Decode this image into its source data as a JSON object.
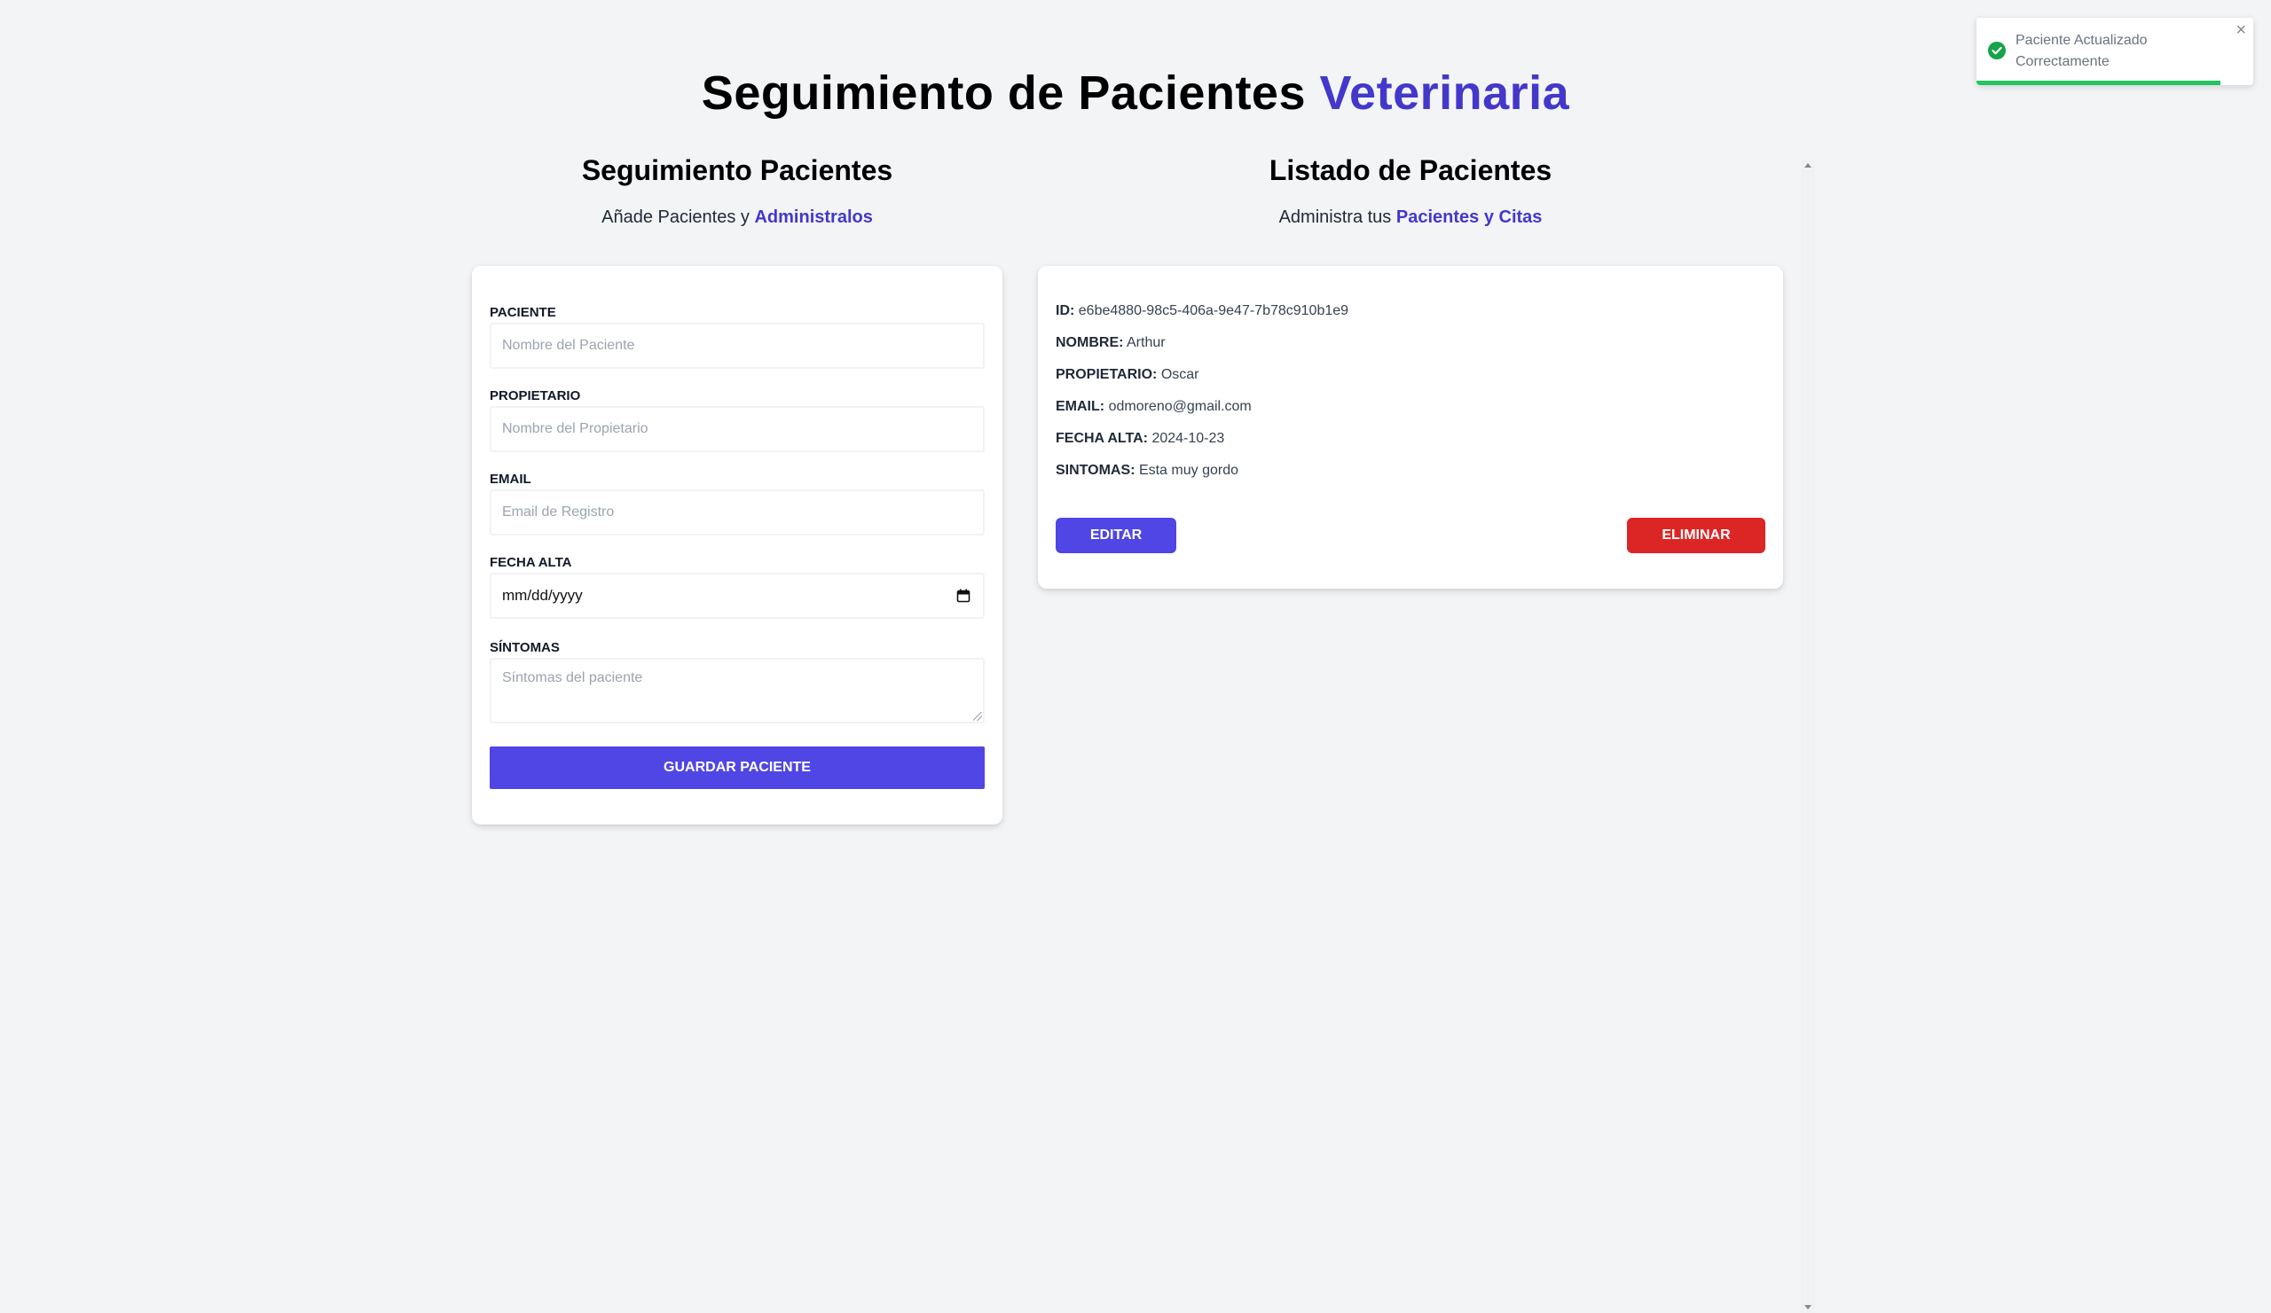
{
  "header": {
    "title_main": "Seguimiento de Pacientes",
    "title_accent": "Veterinaria"
  },
  "form_section": {
    "heading": "Seguimiento Pacientes",
    "subtitle_prefix": "Añade Pacientes y",
    "subtitle_accent": "Administralos",
    "fields": {
      "paciente": {
        "label": "PACIENTE",
        "placeholder": "Nombre del Paciente",
        "value": ""
      },
      "propietario": {
        "label": "PROPIETARIO",
        "placeholder": "Nombre del Propietario",
        "value": ""
      },
      "email": {
        "label": "EMAIL",
        "placeholder": "Email de Registro",
        "value": ""
      },
      "fecha_alta": {
        "label": "FECHA ALTA",
        "display": "mm/dd/yyyy"
      },
      "sintomas": {
        "label": "SÍNTOMAS",
        "placeholder": "Síntomas del paciente",
        "value": ""
      }
    },
    "submit_label": "GUARDAR PACIENTE"
  },
  "list_section": {
    "heading": "Listado de Pacientes",
    "subtitle_prefix": "Administra tus",
    "subtitle_accent": "Pacientes y Citas",
    "patients": [
      {
        "id_label": "ID:",
        "id": "e6be4880-98c5-406a-9e47-7b78c910b1e9",
        "nombre_label": "NOMBRE:",
        "nombre": "Arthur",
        "propietario_label": "PROPIETARIO:",
        "propietario": "Oscar",
        "email_label": "EMAIL:",
        "email": "odmoreno@gmail.com",
        "fecha_label": "FECHA ALTA:",
        "fecha": "2024-10-23",
        "sintomas_label": "SINTOMAS:",
        "sintomas": "Esta muy gordo",
        "edit_label": "EDITAR",
        "delete_label": "ELIMINAR"
      }
    ]
  },
  "toast": {
    "message": "Paciente Actualizado Correctamente",
    "close_symbol": "×",
    "progress": 0.88,
    "icon": "check-circle-icon"
  },
  "colors": {
    "accent": "#4338ca",
    "primary_button": "#4f46e5",
    "danger_button": "#dc2626",
    "success": "#22c55e",
    "background": "#f3f4f6"
  }
}
